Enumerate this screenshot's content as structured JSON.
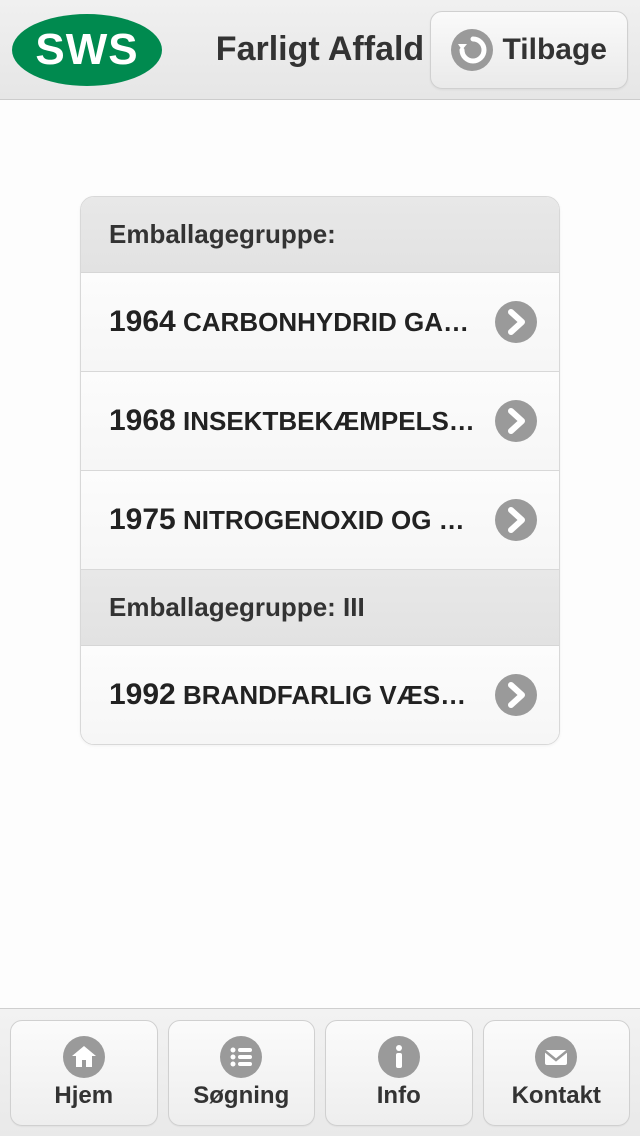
{
  "header": {
    "logo_text": "SWS",
    "title": "Farligt Affald",
    "back_label": "Tilbage"
  },
  "list": {
    "groups": [
      {
        "header": "Emballagegruppe:",
        "items": [
          {
            "code": "1964",
            "name": "CARBONHYDRID GA…"
          },
          {
            "code": "1968",
            "name": "INSEKTBEKÆMPELS…"
          },
          {
            "code": "1975",
            "name": "NITROGENOXID OG …"
          }
        ]
      },
      {
        "header": "Emballagegruppe: III",
        "items": [
          {
            "code": "1992",
            "name": "BRANDFARLIG VÆS…"
          }
        ]
      }
    ]
  },
  "footer": {
    "items": [
      {
        "label": "Hjem",
        "icon": "home-icon"
      },
      {
        "label": "Søgning",
        "icon": "list-icon"
      },
      {
        "label": "Info",
        "icon": "info-icon"
      },
      {
        "label": "Kontakt",
        "icon": "mail-icon"
      }
    ]
  },
  "colors": {
    "brand_green": "#008a4f",
    "icon_gray": "#9a9a9a"
  }
}
